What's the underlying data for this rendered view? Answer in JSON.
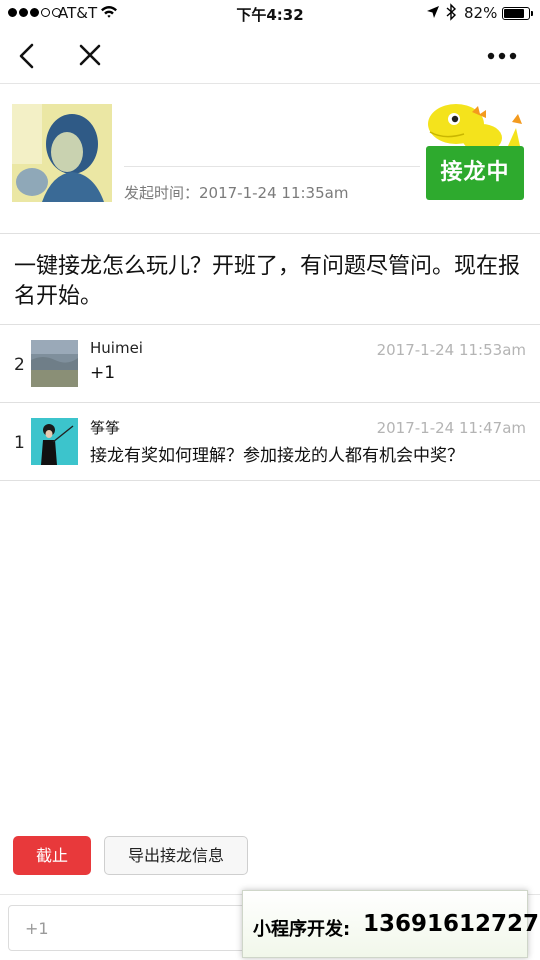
{
  "status_bar": {
    "carrier": "AT&T",
    "time": "下午4:32",
    "battery": "82%",
    "battery_level": 0.82
  },
  "nav": {
    "back_icon": "back-chevron-icon",
    "close_icon": "close-icon",
    "more_icon": "more-dots-icon"
  },
  "header": {
    "created_time": "发起时间：2017-1-24 11:35am",
    "badge": "接龙中",
    "badge_color": "#2eaa2e"
  },
  "topic": "一键接龙怎么玩儿？开班了，有问题尽管问。现在报名开始。",
  "entries": [
    {
      "index": "2",
      "name": "Huimei",
      "time": "2017-1-24 11:53am",
      "text": "+1"
    },
    {
      "index": "1",
      "name": "筝筝",
      "time": "2017-1-24 11:47am",
      "text": "接龙有奖如何理解？参加接龙的人都有机会中奖？"
    }
  ],
  "actions": {
    "stop_label": "截止",
    "stop_color": "#e8393b",
    "export_label": "导出接龙信息"
  },
  "input": {
    "placeholder": "+1"
  },
  "promo": {
    "label": "小程序开发:",
    "phone": "13691612727"
  }
}
